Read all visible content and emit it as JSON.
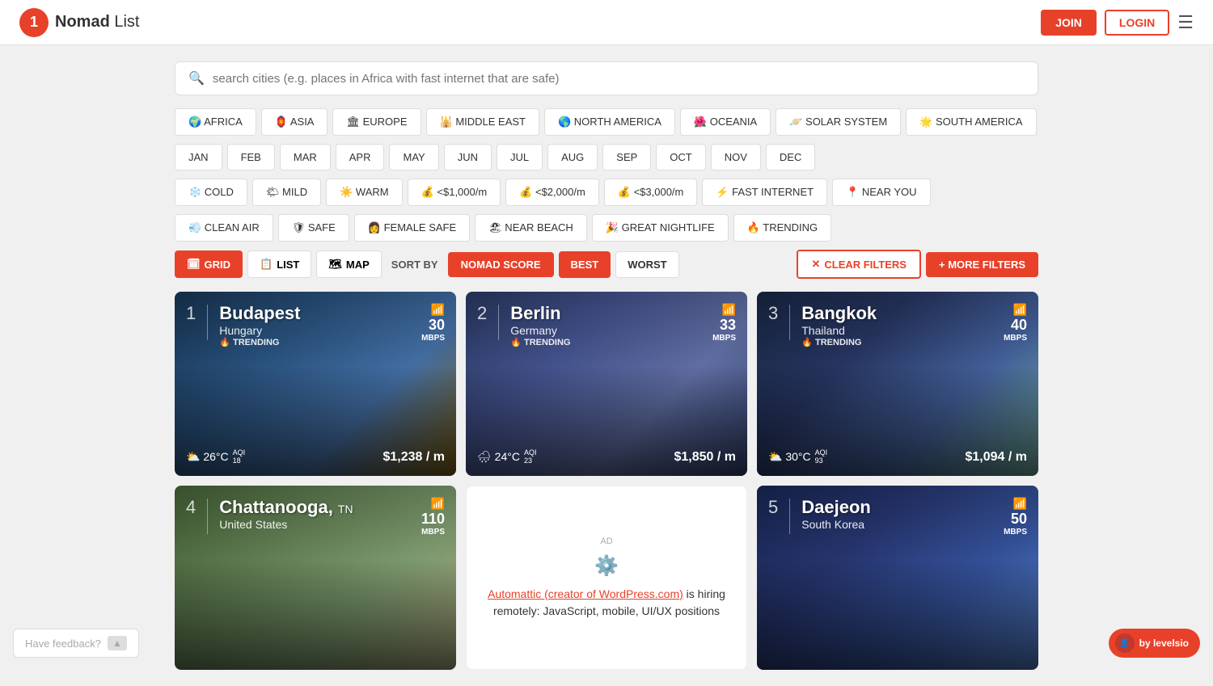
{
  "header": {
    "logo_letter": "1",
    "logo_brand": "Nomad",
    "logo_suffix": " List",
    "join_label": "JOIN",
    "login_label": "LOGIN"
  },
  "search": {
    "placeholder": "search cities (e.g. places in Africa with fast internet that are safe)"
  },
  "region_filters": [
    {
      "icon": "🌍",
      "label": "AFRICA"
    },
    {
      "icon": "🏮",
      "label": "ASIA"
    },
    {
      "icon": "🏛",
      "label": "EUROPE"
    },
    {
      "icon": "🕌",
      "label": "MIDDLE EAST"
    },
    {
      "icon": "🌎",
      "label": "NORTH AMERICA"
    },
    {
      "icon": "🌺",
      "label": "OCEANIA"
    },
    {
      "icon": "🪐",
      "label": "SOLAR SYSTEM"
    },
    {
      "icon": "🌟",
      "label": "SOUTH AMERICA"
    }
  ],
  "month_filters": [
    "JAN",
    "FEB",
    "MAR",
    "APR",
    "MAY",
    "JUN",
    "JUL",
    "AUG",
    "SEP",
    "OCT",
    "NOV",
    "DEC"
  ],
  "climate_filters": [
    {
      "icon": "❄️",
      "label": "COLD"
    },
    {
      "icon": "🌤",
      "label": "MILD"
    },
    {
      "icon": "☀️",
      "label": "WARM"
    }
  ],
  "cost_filters": [
    {
      "icon": "💰",
      "label": "<$1,000/m"
    },
    {
      "icon": "💰",
      "label": "<$2,000/m"
    },
    {
      "icon": "💰",
      "label": "<$3,000/m"
    }
  ],
  "special_filters": [
    {
      "icon": "⚡",
      "label": "FAST INTERNET"
    },
    {
      "icon": "📍",
      "label": "NEAR YOU"
    }
  ],
  "extra_filters": [
    {
      "icon": "💨",
      "label": "CLEAN AIR"
    },
    {
      "icon": "🛡",
      "label": "SAFE"
    },
    {
      "icon": "👩",
      "label": "FEMALE SAFE"
    },
    {
      "icon": "🏖",
      "label": "NEAR BEACH"
    },
    {
      "icon": "🎉",
      "label": "GREAT NIGHTLIFE"
    },
    {
      "icon": "🔥",
      "label": "TRENDING"
    }
  ],
  "view_controls": {
    "grid_label": "GRID",
    "list_label": "LIST",
    "map_label": "MAP",
    "sort_label": "SORT BY",
    "nomad_score_label": "NOMAD SCORE",
    "best_label": "BEST",
    "worst_label": "WORST",
    "clear_filters_label": "CLEAR FILTERS",
    "more_filters_label": "+ MORE FILTERS"
  },
  "cities": [
    {
      "rank": "1",
      "name": "Budapest",
      "country": "Hungary",
      "badge": "🔥 TRENDING",
      "wifi": "30",
      "wifi_unit": "MBPS",
      "temp": "26°C",
      "aqi": "18",
      "cost": "$1,238 / m",
      "weather_icon": "⛅",
      "bg_class": "budapest-bg"
    },
    {
      "rank": "2",
      "name": "Berlin",
      "country": "Germany",
      "badge": "🔥 TRENDING",
      "wifi": "33",
      "wifi_unit": "MBPS",
      "temp": "24°C",
      "aqi": "23",
      "cost": "$1,850 / m",
      "weather_icon": "🌧",
      "bg_class": "berlin-bg"
    },
    {
      "rank": "3",
      "name": "Bangkok",
      "country": "Thailand",
      "badge": "🔥 TRENDING",
      "wifi": "40",
      "wifi_unit": "MBPS",
      "temp": "30°C",
      "aqi": "93",
      "cost": "$1,094 / m",
      "weather_icon": "⛅",
      "bg_class": "bangkok-bg"
    },
    {
      "rank": "4",
      "name": "Chattanooga,",
      "name2": "TN",
      "country": "United States",
      "badge": "",
      "wifi": "110",
      "wifi_unit": "MBPS",
      "temp": "",
      "aqi": "",
      "cost": "",
      "weather_icon": "",
      "bg_class": "chattanooga-bg"
    }
  ],
  "ad": {
    "label": "AD",
    "logo": "⚙️",
    "text": "Automattic (creator of WordPress.com) is hiring remotely: JavaScript, mobile, UI/UX positions"
  },
  "city5": {
    "rank": "5",
    "name": "Daejeon",
    "country": "South Korea",
    "wifi": "50",
    "wifi_unit": "MBPS",
    "bg_class": "daejeon-bg"
  },
  "feedback": {
    "label": "Have feedback?",
    "arrow": "▲"
  },
  "levels_badge": "by levelsio"
}
